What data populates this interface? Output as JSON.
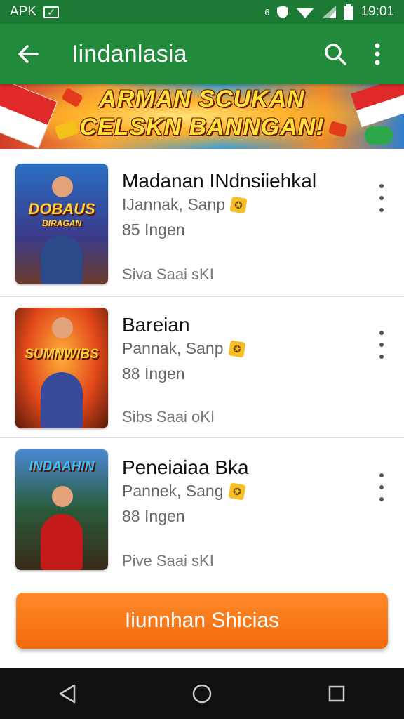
{
  "status_bar": {
    "left_label": "APK",
    "check_glyph": "✓",
    "signal_label": "6",
    "time": "19:01",
    "icons": [
      "check-box-icon",
      "shield-icon",
      "wifi-icon",
      "signal-icon",
      "battery-icon"
    ]
  },
  "app_bar": {
    "title": "Iindanlasia",
    "icons": [
      "back-arrow-icon",
      "search-icon",
      "more-vert-icon"
    ]
  },
  "banner": {
    "line1": "ARMAN SCUKAN",
    "line2": "CELSKN BANNGAN!"
  },
  "items": [
    {
      "name": "Madanan INdnsiiehkal",
      "developer": "IJannak, Sanp",
      "size": "85 Ingen",
      "meta": "Siva Saai   sKI",
      "thumb_text_1": "DOBAUS",
      "thumb_text_2": "BIRAGAN"
    },
    {
      "name": "Bareian",
      "developer": "Pannak, Sanp",
      "size": "88 Ingen",
      "meta": "Sibs Saai   oKI",
      "thumb_text_1": "SUMNWIBS",
      "thumb_text_2": ""
    },
    {
      "name": "Peneiaiaa Bka",
      "developer": "Pannek, Sang",
      "size": "88 Ingen",
      "meta": "Pive Saai   sKI",
      "thumb_text_1": "INDAAHIN",
      "thumb_text_2": ""
    }
  ],
  "badge_glyph": "✪",
  "button": {
    "label": "Iiunnhan Shicias"
  },
  "colors": {
    "status_bar": "#1d7a34",
    "app_bar": "#218a3b",
    "button": "#f26a0c",
    "nav_bar": "#111111"
  },
  "nav_bar": {
    "icons": [
      "back-triangle-icon",
      "home-circle-icon",
      "recents-square-icon"
    ]
  }
}
